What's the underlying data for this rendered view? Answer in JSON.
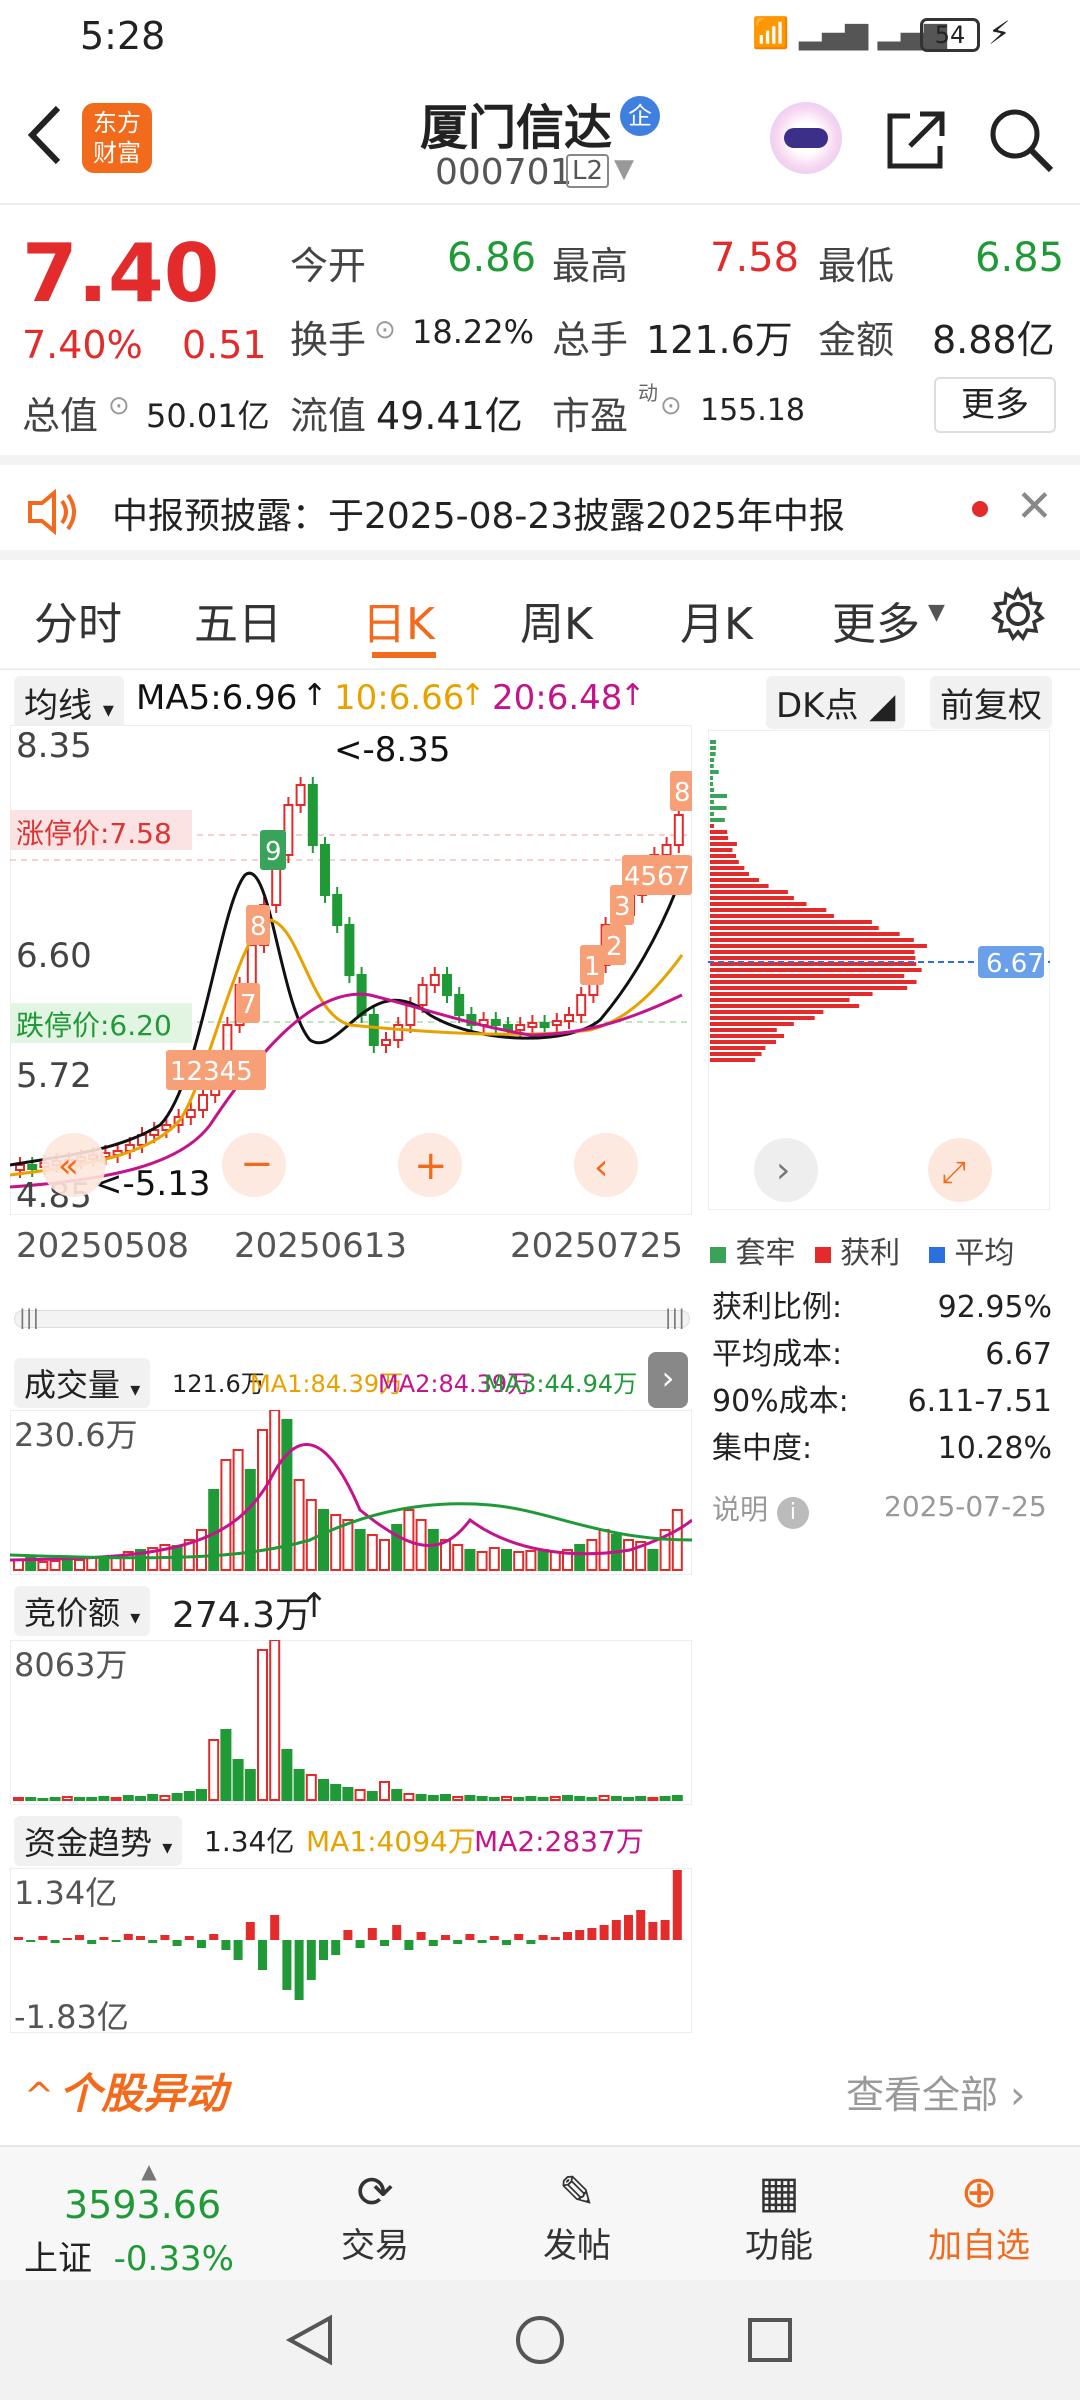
{
  "status": {
    "time": "5:28",
    "battery": "54"
  },
  "header": {
    "logo": "东方财富",
    "title": "厦门信达",
    "badge": "企",
    "code": "000701",
    "level": "L2"
  },
  "quote": {
    "price": "7.40",
    "change_pct": "7.40%",
    "change": "0.51",
    "open_label": "今开",
    "open": "6.86",
    "high_label": "最高",
    "high": "7.58",
    "low_label": "最低",
    "low": "6.85",
    "turnover_label": "换手",
    "turnover": "18.22%",
    "volume_label": "总手",
    "volume": "121.6万",
    "amount_label": "金额",
    "amount": "8.88亿",
    "mcap_label": "总值",
    "mcap": "50.01亿",
    "float_label": "流值",
    "float": "49.41亿",
    "pe_label": "市盈",
    "pe_sup": "动",
    "pe": "155.18",
    "more": "更多"
  },
  "notice": {
    "text": "中报预披露：于2025-08-23披露2025年中报"
  },
  "tabs": [
    {
      "label": "分时"
    },
    {
      "label": "五日"
    },
    {
      "label": "日K",
      "active": true
    },
    {
      "label": "周K"
    },
    {
      "label": "月K"
    },
    {
      "label": "更多"
    }
  ],
  "kline": {
    "ma_selector": "均线",
    "ma5": "MA5:6.96",
    "ma10": "10:6.66",
    "ma20": "20:6.48",
    "dk": "DK点",
    "fq": "前复权",
    "y_labels": [
      "8.35",
      "6.60",
      "5.72",
      "4.85"
    ],
    "limit_up": "涨停价:7.58",
    "limit_down": "跌停价:6.20",
    "peak_note": "<-8.35",
    "low_note": "<-5.13",
    "dates": [
      "20250508",
      "20250613",
      "20250725"
    ],
    "avg_cost_tag": "6.67",
    "colors": {
      "up": "#e32b2b",
      "down": "#1f9a37",
      "ma5": "#111111",
      "ma10": "#e8a200",
      "ma20": "#c4148c"
    }
  },
  "chips": {
    "legend": [
      "套牢",
      "获利",
      "平均"
    ],
    "rows": [
      {
        "k": "获利比例:",
        "v": "92.95%"
      },
      {
        "k": "平均成本:",
        "v": "6.67"
      },
      {
        "k": "90%成本:",
        "v": "6.11-7.51"
      },
      {
        "k": "集中度:",
        "v": "10.28%"
      }
    ],
    "note": "说明",
    "date": "2025-07-25"
  },
  "volume": {
    "selector": "成交量",
    "total": "121.6万",
    "ma1": "MA1:84.39万",
    "ma2": "MA2:84.39万",
    "ma3": "MA3:44.94万",
    "ymax": "230.6万"
  },
  "auction": {
    "selector": "竞价额",
    "value": "274.3万",
    "ymax": "8063万"
  },
  "fund": {
    "selector": "资金趋势",
    "value": "1.34亿",
    "ma1": "MA1:4094万",
    "ma2": "MA2:2837万",
    "ymax": "1.34亿",
    "ymin": "-1.83亿"
  },
  "movement": {
    "title": "个股异动",
    "link": "查看全部"
  },
  "bottom": {
    "index_value": "3593.66",
    "index_name": "上证",
    "index_change": "-0.33%",
    "items": [
      {
        "label": "交易"
      },
      {
        "label": "发帖"
      },
      {
        "label": "功能"
      },
      {
        "label": "加自选"
      }
    ]
  }
}
